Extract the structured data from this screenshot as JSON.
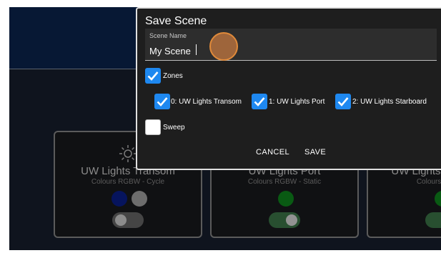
{
  "dialog": {
    "title": "Save Scene",
    "scene_name_label": "Scene Name",
    "scene_name_value": "My Scene",
    "zones_label": "Zones",
    "zones": [
      {
        "label": "0: UW Lights Transom",
        "checked": true
      },
      {
        "label": "1: UW Lights Port",
        "checked": true
      },
      {
        "label": "2: UW Lights Starboard",
        "checked": true
      }
    ],
    "sweep_label": "Sweep",
    "cancel_label": "CANCEL",
    "save_label": "SAVE"
  },
  "cards": [
    {
      "title": "UW Lights Transom",
      "subtitle": "Colours RGBW - Cycle",
      "colors": [
        "#0a1f8f",
        "#a8a8a8"
      ],
      "toggle_on": false
    },
    {
      "title": "UW Lights Port",
      "subtitle": "Colours RGBW - Static",
      "colors": [
        "#0e8a1e"
      ],
      "toggle_on": true
    },
    {
      "title": "UW Lights Starboard",
      "subtitle": "Colours RGBW",
      "colors": [
        "#0e8a1e"
      ],
      "toggle_on": true
    }
  ],
  "colors": {
    "checkbox_accent": "#1e88f0",
    "topbar": "#0c2550",
    "touch_indicator": "#c47840"
  }
}
